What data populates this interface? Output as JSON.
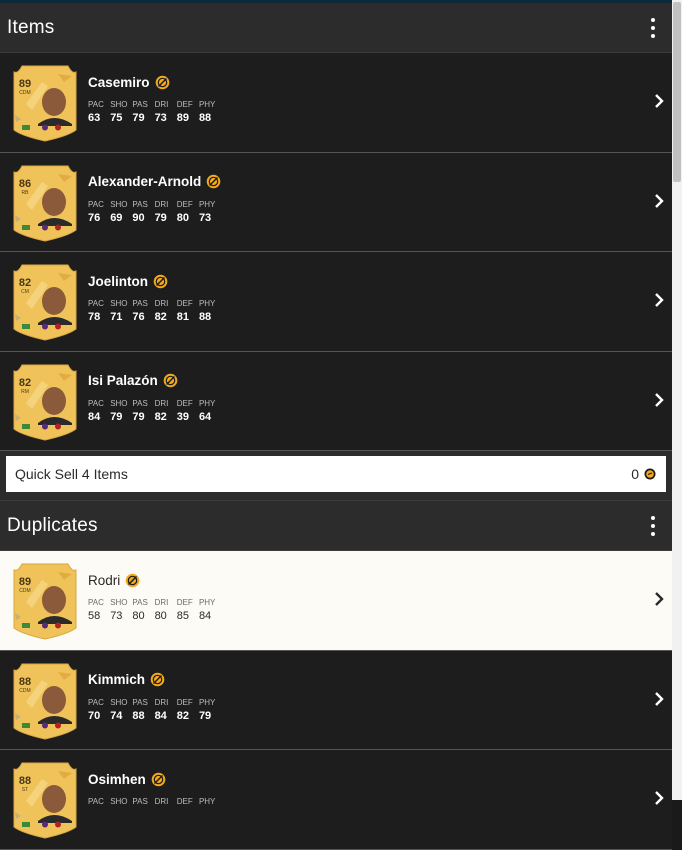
{
  "colors": {
    "accent": "#f2a91c",
    "card_gold": "#f0c35a",
    "dark_row": "#1d1d1d",
    "header": "#2c2c2c"
  },
  "stat_labels": [
    "PAC",
    "SHO",
    "PAS",
    "DRI",
    "DEF",
    "PHY"
  ],
  "items_section": {
    "title": "Items",
    "menu_icon": "more-vertical-icon",
    "players": [
      {
        "name": "Casemiro",
        "rating": "89",
        "position": "CDM",
        "stats": [
          "63",
          "75",
          "79",
          "73",
          "89",
          "88"
        ]
      },
      {
        "name": "Alexander-Arnold",
        "rating": "86",
        "position": "RB",
        "stats": [
          "76",
          "69",
          "90",
          "79",
          "80",
          "73"
        ]
      },
      {
        "name": "Joelinton",
        "rating": "82",
        "position": "CM",
        "stats": [
          "78",
          "71",
          "76",
          "82",
          "81",
          "88"
        ]
      },
      {
        "name": "Isi Palazón",
        "rating": "82",
        "position": "RM",
        "stats": [
          "84",
          "79",
          "79",
          "82",
          "39",
          "64"
        ]
      }
    ],
    "quick_sell": {
      "label": "Quick Sell 4 Items",
      "value": "0",
      "icon": "coin-icon"
    }
  },
  "duplicates_section": {
    "title": "Duplicates",
    "menu_icon": "more-vertical-icon",
    "players": [
      {
        "name": "Rodri",
        "rating": "89",
        "position": "CDM",
        "stats": [
          "58",
          "73",
          "80",
          "80",
          "85",
          "84"
        ],
        "selected": true
      },
      {
        "name": "Kimmich",
        "rating": "88",
        "position": "CDM",
        "stats": [
          "70",
          "74",
          "88",
          "84",
          "82",
          "79"
        ]
      },
      {
        "name": "Osimhen",
        "rating": "88",
        "position": "ST",
        "stats": [
          "",
          "",
          "",
          "",
          "",
          ""
        ]
      }
    ]
  }
}
